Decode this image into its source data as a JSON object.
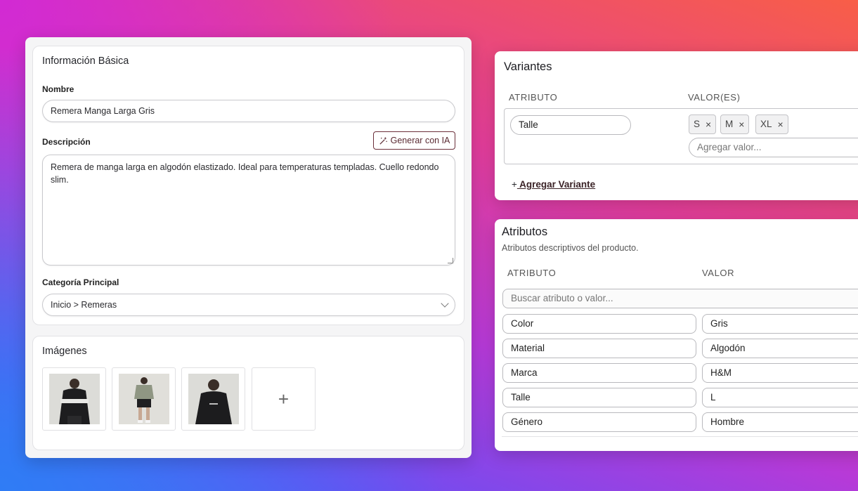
{
  "basic_info": {
    "title": "Información Básica",
    "name_label": "Nombre",
    "name_value": "Remera Manga Larga Gris",
    "description_label": "Descripción",
    "generate_ai_label": "Generar con IA",
    "description_value": "Remera de manga larga en algodón elastizado. Ideal para temperaturas templadas. Cuello redondo slim.",
    "category_label": "Categoría Principal",
    "category_value": "Inicio > Remeras"
  },
  "images": {
    "title": "Imágenes",
    "add_symbol": "+",
    "items": [
      {
        "icon": "product-photo-black-sweatshirt"
      },
      {
        "icon": "product-photo-olive-tshirt-shorts"
      },
      {
        "icon": "product-photo-black-zip-jacket"
      }
    ]
  },
  "variants": {
    "title": "Variantes",
    "col_attribute": "ATRIBUTO",
    "col_values": "VALOR(ES)",
    "attribute_value": "Talle",
    "chips": [
      "S",
      "M",
      "XL"
    ],
    "chip_remove_symbol": "×",
    "add_value_placeholder": "Agregar valor...",
    "add_variant_prefix": "+",
    "add_variant_label": " Agregar Variante"
  },
  "attributes": {
    "title": "Atributos",
    "subtitle": "Atributos descriptivos del producto.",
    "col_attribute": "ATRIBUTO",
    "col_value": "VALOR",
    "search_placeholder": "Buscar atributo o valor...",
    "rows": [
      {
        "attribute": "Color",
        "value": "Gris"
      },
      {
        "attribute": "Material",
        "value": "Algodón"
      },
      {
        "attribute": "Marca",
        "value": "H&M"
      },
      {
        "attribute": "Talle",
        "value": "L"
      },
      {
        "attribute": "Género",
        "value": "Hombre"
      }
    ]
  },
  "colors": {
    "accent_button_border": "#6b2f3a",
    "card_background": "#ffffff",
    "window_background": "#f5f5f6"
  }
}
